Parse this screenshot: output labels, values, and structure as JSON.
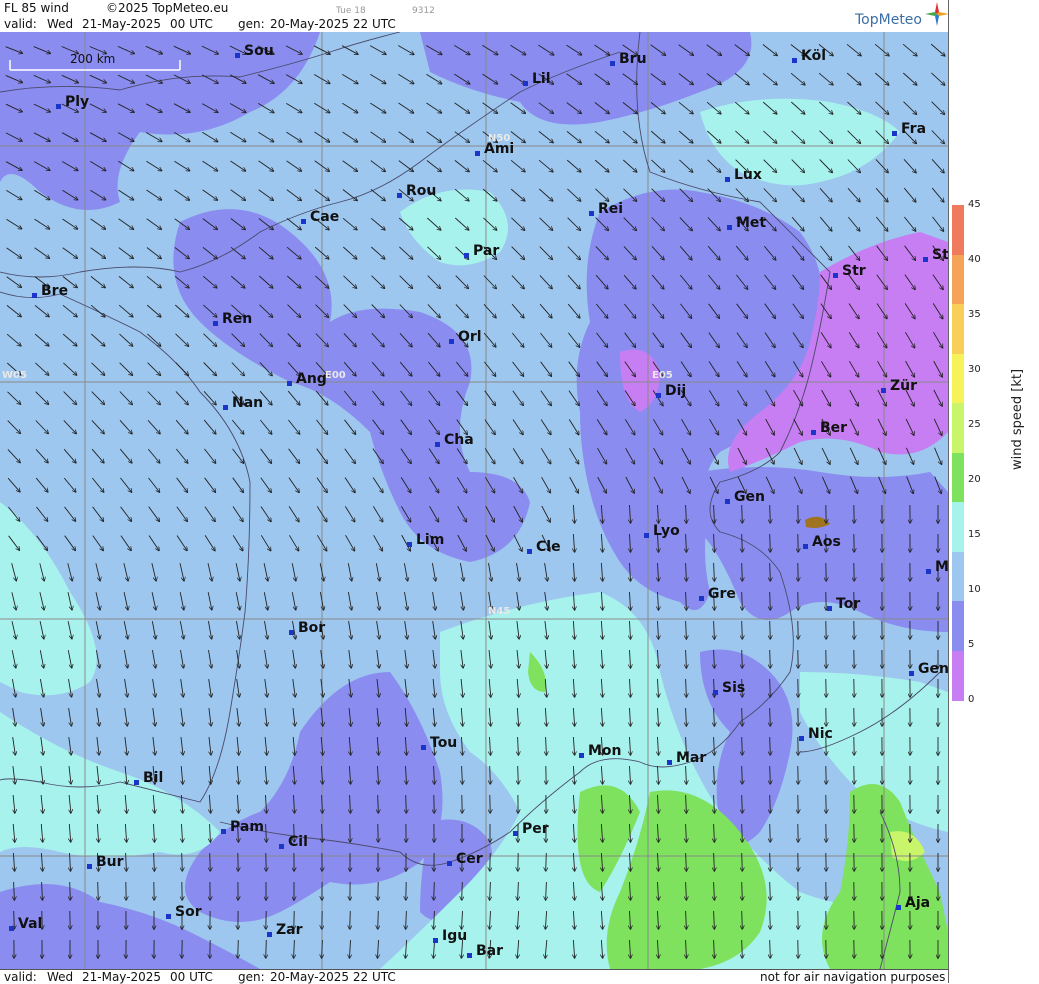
{
  "header": {
    "product": "FL 85 wind",
    "copyright": "©2025 TopMeteo.eu",
    "small_day": "Tue 18",
    "small_code": "9312",
    "valid_label": "valid:",
    "valid_day": "Wed",
    "valid_date": "21-May-2025",
    "valid_time": "00 UTC",
    "gen_label": "gen:",
    "gen_value": "20-May-2025 22 UTC",
    "logo": "TopMeteo"
  },
  "footer": {
    "valid_label": "valid:",
    "valid_day": "Wed",
    "valid_date": "21-May-2025",
    "valid_time": "00 UTC",
    "gen_label": "gen:",
    "gen_value": "20-May-2025 22 UTC",
    "disclaimer": "not for air navigation purposes"
  },
  "map": {
    "scale_label": "200 km",
    "grid_labels": {
      "n50": "N50",
      "n45": "N45",
      "w05": "W05",
      "e00": "E00",
      "e05": "E05"
    },
    "cities": [
      {
        "name": "Sou"
      },
      {
        "name": "Lil"
      },
      {
        "name": "Bru"
      },
      {
        "name": "Köl"
      },
      {
        "name": "Ply"
      },
      {
        "name": "Ami"
      },
      {
        "name": "Fra"
      },
      {
        "name": "Lux"
      },
      {
        "name": "Rou"
      },
      {
        "name": "Cae"
      },
      {
        "name": "Rei"
      },
      {
        "name": "Met"
      },
      {
        "name": "Par"
      },
      {
        "name": "Stu"
      },
      {
        "name": "Str"
      },
      {
        "name": "Bre"
      },
      {
        "name": "Ren"
      },
      {
        "name": "Orl"
      },
      {
        "name": "Ang"
      },
      {
        "name": "Nan"
      },
      {
        "name": "Dij"
      },
      {
        "name": "Zür"
      },
      {
        "name": "Ber"
      },
      {
        "name": "Cha"
      },
      {
        "name": "Gen"
      },
      {
        "name": "Lim"
      },
      {
        "name": "Cle"
      },
      {
        "name": "Lyo"
      },
      {
        "name": "Aos"
      },
      {
        "name": "Mil"
      },
      {
        "name": "Gre"
      },
      {
        "name": "Tor"
      },
      {
        "name": "Bor"
      },
      {
        "name": "Sis"
      },
      {
        "name": "Gen"
      },
      {
        "name": "Tou"
      },
      {
        "name": "Mon"
      },
      {
        "name": "Mar"
      },
      {
        "name": "Nic"
      },
      {
        "name": "Bil"
      },
      {
        "name": "Pam"
      },
      {
        "name": "Per"
      },
      {
        "name": "Cil"
      },
      {
        "name": "Bur"
      },
      {
        "name": "Cer"
      },
      {
        "name": "Sor"
      },
      {
        "name": "Aja"
      },
      {
        "name": "Val"
      },
      {
        "name": "Zar"
      },
      {
        "name": "Igu"
      },
      {
        "name": "Bar"
      }
    ]
  },
  "legend": {
    "label": "wind speed [kt]",
    "ticks": [
      "45",
      "40",
      "35",
      "30",
      "25",
      "20",
      "15",
      "10",
      "5",
      "0"
    ],
    "colors": [
      "#f07a5e",
      "#f6a35a",
      "#f8cf58",
      "#f5f25a",
      "#c8f56a",
      "#7ee25e",
      "#a8f2ee",
      "#9dc7ee",
      "#8a8cf0",
      "#c77ef2"
    ]
  }
}
